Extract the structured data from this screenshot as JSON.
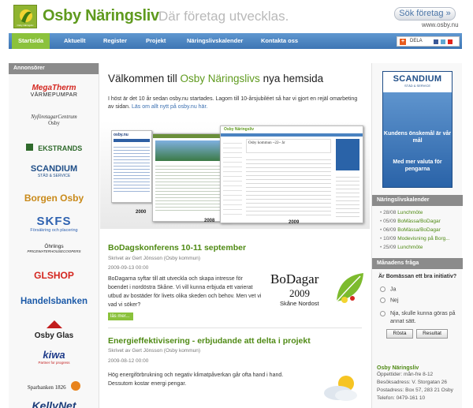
{
  "header": {
    "logo_name": "Osby Näringsliv",
    "logo_sub": "Osby Näringsliv",
    "tagline": "Där företag utvecklas.",
    "search_button": "Sök företag »",
    "site_url": "www.osby.nu"
  },
  "nav": {
    "items": [
      "Startsida",
      "Aktuellt",
      "Register",
      "Projekt",
      "Näringslivskalender",
      "Kontakta oss"
    ],
    "share_label": "DELA"
  },
  "left": {
    "heading": "Annonsörer",
    "sponsors": [
      {
        "name": "MegaTherm",
        "sub": "VÄRMEPUMPAR"
      },
      {
        "name": "NyföretagarCentrum",
        "sub": "Osby"
      },
      {
        "name": "EKSTRANDS"
      },
      {
        "name": "SCANDIUM",
        "sub": "STÄD & SERVICE"
      },
      {
        "name": "Borgen Osby"
      },
      {
        "name": "SKFS",
        "sub": "Försäkring och placering"
      },
      {
        "name": "Öhrlings",
        "sub": "PRICEWATERHOUSECOOPERS"
      },
      {
        "name": "GLSHOP"
      },
      {
        "name": "Handelsbanken"
      },
      {
        "name": "Osby Glas"
      },
      {
        "name": "kiwa",
        "sub": "Partner for progress"
      },
      {
        "name": "Sparbanken 1826"
      },
      {
        "name": "KellyNet"
      }
    ]
  },
  "center": {
    "welcome_pre": "Välkommen till ",
    "welcome_accent": "Osby Näringslivs",
    "welcome_post": " nya hemsida",
    "intro": "I höst är det 10 år sedan osby.nu startades. Lagom till 10-årsjubiléet så har vi gjort en rejäl omarbeting av sidan. ",
    "intro_link": "Läs om allt nytt på osby.nu här.",
    "screens": {
      "captions": [
        "2000",
        "2008",
        "2009"
      ],
      "site_title_old": "osby.nu",
      "site_title_new": "Osby Näringsliv",
      "banner": "Osby kommun ~22~ år"
    },
    "articles": [
      {
        "title": "BoDagskonferens 10-11 september",
        "meta": "Skrivet av Gert Jönsson (Osby kommun)",
        "date": "2009-09-13 00:00",
        "body": "BoDagarna syftar till att utveckla och skapa intresse för boendet i nordöstra Skåne. Vi vill kunna erbjuda ett varierat utbud av bostäder för livets olika skeden och behov. Men vet vi vad vi söker?",
        "read_more": "läs mer...",
        "logo_title": "BoDagar",
        "logo_year": "2009",
        "logo_sub": "Skåne Nordost"
      },
      {
        "title": "Energieffektivisering - erbjudande att delta i projekt",
        "meta": "Skrivet av Gert Jönsson (Osby kommun)",
        "date": "2009-08-12 00:00",
        "body": "Hög energiförbrukning och negativ klimatpåverkan går ofta hand i hand. Dessutom kostar energi pengar."
      }
    ]
  },
  "right": {
    "ad": {
      "brand": "SCANDIUM",
      "brand_sub": "STÄD & SERVICE",
      "slogan": "Kundens önskemål är vår mål",
      "tagline": "Med mer valuta för pengarna"
    },
    "calendar_heading": "Näringslivskalender",
    "calendar": [
      {
        "date": "28/08",
        "title": "Lunchmöte"
      },
      {
        "date": "05/09",
        "title": "BoMässa/BoDagar"
      },
      {
        "date": "06/09",
        "title": "BoMässa/BoDagar"
      },
      {
        "date": "10/09",
        "title": "Modevisning på Borg..."
      },
      {
        "date": "25/09",
        "title": "Lunchmöte"
      }
    ],
    "poll_heading": "Månadens fråga",
    "poll_question": "Är Bomässan ett bra initiativ?",
    "poll_options": [
      "Ja",
      "Nej",
      "Nja, skulle kunna göras på annat sätt."
    ],
    "poll_vote": "Rösta",
    "poll_result": "Resultat",
    "contact": {
      "title": "Osby Näringsliv",
      "lines": [
        "Öppettider: mån-fre 8-12",
        "Besöksadress: V. Storgatan 26",
        "Postadress: Box 57, 283 21 Osby",
        "Telefon: 0479-161 10"
      ]
    }
  },
  "colors": {
    "brand_green": "#5f9a1e",
    "nav_blue": "#4a83c1",
    "active_green": "#8bc23c"
  }
}
